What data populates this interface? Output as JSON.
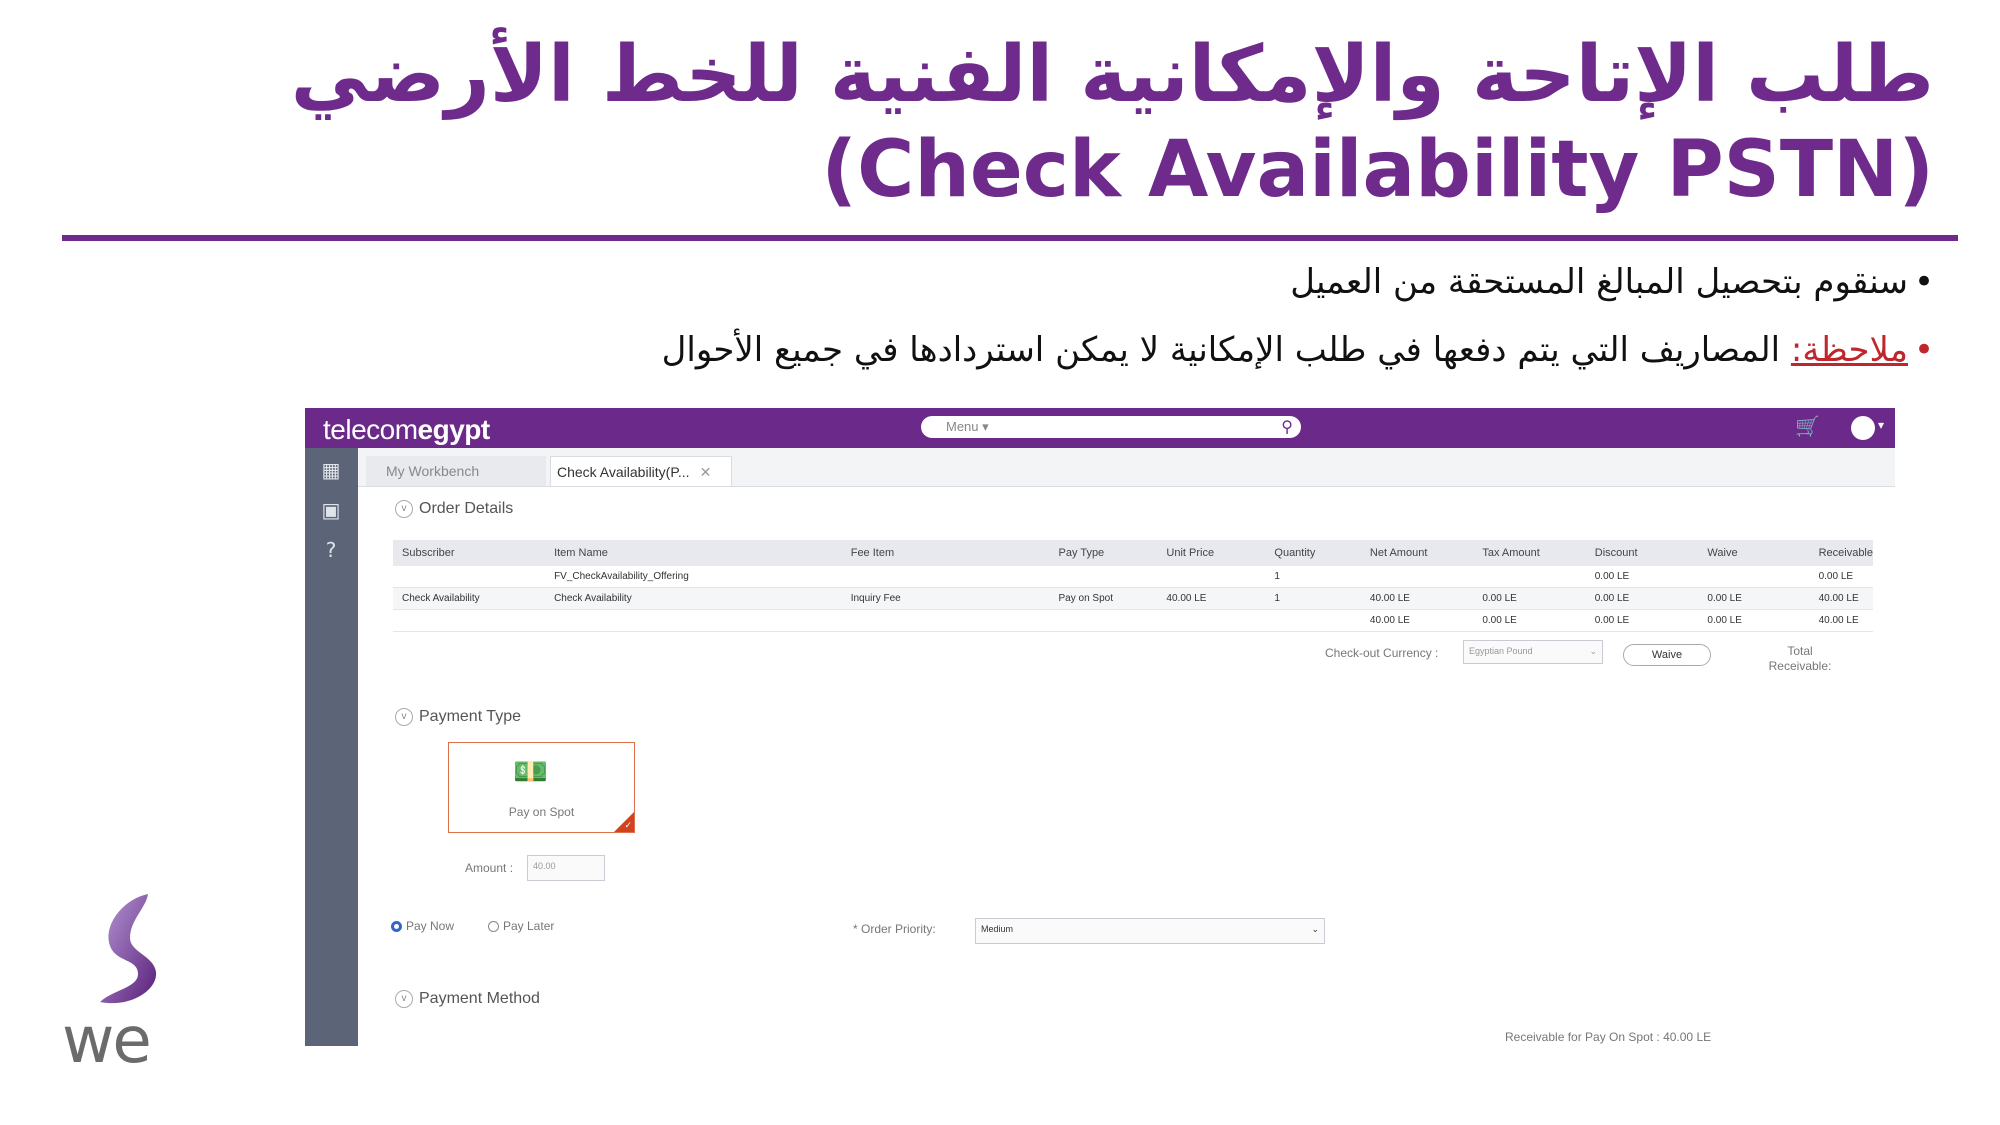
{
  "slide": {
    "title_ar": "طلب الإتاحة والإمكانية الفنية للخط الأرضي",
    "title_en": "(Check Availability PSTN)",
    "bullets": [
      {
        "text": "سنقوم بتحصيل المبالغ المستحقة من العميل"
      },
      {
        "label": "ملاحظة:",
        "text": " المصاريف التي يتم دفعها في طلب الإمكانية لا يمكن استردادها في جميع الأحوال"
      }
    ],
    "brand_logo": "we",
    "colors": {
      "brand_purple": "#6e2b8c",
      "note_red": "#c0272d"
    }
  },
  "app": {
    "logo_light": "telecom",
    "logo_bold": "egypt",
    "search_placeholder": "Menu ▾",
    "icons": [
      "search-icon",
      "cart-icon",
      "avatar-icon",
      "dashboard-icon",
      "inbox-icon",
      "help-icon"
    ],
    "tabs": [
      {
        "label": "My Workbench"
      },
      {
        "label": "Check Availability(P..."
      }
    ],
    "order_details": {
      "title": "Order Details",
      "columns": [
        "Subscriber",
        "Item Name",
        "Fee Item",
        "Pay Type",
        "Unit Price",
        "Quantity",
        "Net Amount",
        "Tax Amount",
        "Discount",
        "Waive",
        "Receivable"
      ],
      "rows": [
        [
          "",
          "FV_CheckAvailability_Offering",
          "",
          "",
          "",
          "1",
          "",
          "",
          "0.00 LE",
          "",
          "0.00 LE"
        ],
        [
          "Check Availability",
          "Check Availability",
          "Inquiry Fee",
          "Pay on Spot",
          "40.00 LE",
          "1",
          "40.00 LE",
          "0.00 LE",
          "0.00 LE",
          "0.00 LE",
          "40.00 LE"
        ],
        [
          "",
          "",
          "",
          "",
          "",
          "",
          "40.00 LE",
          "0.00 LE",
          "0.00 LE",
          "0.00 LE",
          "40.00 LE"
        ]
      ],
      "checkout_currency_label": "Check-out Currency :",
      "checkout_currency_value": "Egyptian Pound",
      "waive_button": "Waive",
      "total_receivable_label1": "Total",
      "total_receivable_label2": "Receivable:"
    },
    "payment_type": {
      "title": "Payment Type",
      "card_label": "Pay on Spot",
      "amount_label": "Amount :",
      "amount_value": "40.00",
      "pay_now": "Pay Now",
      "pay_later": "Pay Later",
      "pay_now_selected": true,
      "order_priority_label": "* Order Priority:",
      "order_priority_value": "Medium"
    },
    "payment_method": {
      "title": "Payment Method",
      "receivable_note": "Receivable for Pay On Spot : 40.00 LE"
    }
  }
}
